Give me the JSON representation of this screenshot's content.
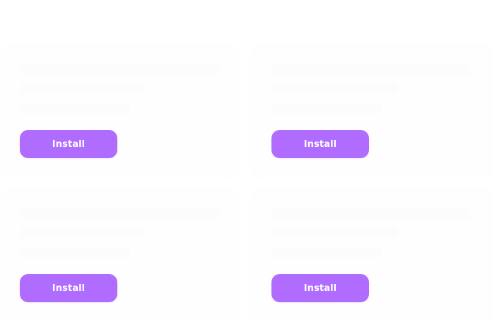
{
  "header": {
    "title": ""
  },
  "cards": [
    {
      "line1": "",
      "line2": "",
      "line3": "",
      "button_label": "Install"
    },
    {
      "line1": "",
      "line2": "",
      "line3": "",
      "button_label": "Install"
    },
    {
      "line1": "",
      "line2": "",
      "line3": "",
      "button_label": "Install"
    },
    {
      "line1": "",
      "line2": "",
      "line3": "",
      "button_label": "Install"
    }
  ],
  "colors": {
    "accent": "#b06bff",
    "button_text": "#ffffff",
    "background": "#ffffff"
  }
}
